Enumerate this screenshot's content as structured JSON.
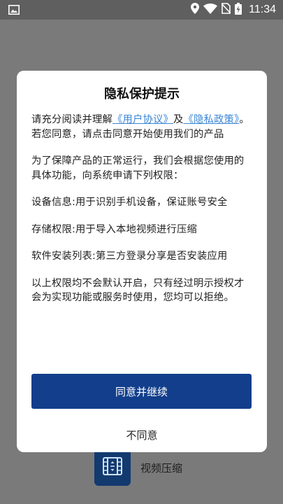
{
  "status_bar": {
    "time": "11:34",
    "icons": [
      "image-notification-icon",
      "location-icon",
      "wifi-icon",
      "no-sim-icon",
      "battery-charging-icon"
    ]
  },
  "dialog": {
    "title": "隐私保护提示",
    "intro_prefix": "请充分阅读并理解",
    "user_agreement_link": "《用户协议》",
    "and": "及",
    "privacy_policy_link": "《隐私政策》",
    "intro_suffix": "。若您同意，请点击同意开始使用我们的产品",
    "purpose": "为了保障产品的正常运行，我们会根据您使用的具体功能，向系统申请下列权限：",
    "permission_device": "设备信息:用于识别手机设备，保证账号安全",
    "permission_storage": "存储权限:用于导入本地视频进行压缩",
    "permission_apps": "软件安装列表:第三方登录分享是否安装应用",
    "closing": "以上权限均不会默认开启，只有经过明示授权才会为实现功能或服务时使用，您均可以拒绝。",
    "agree_button": "同意并继续",
    "disagree_button": "不同意"
  },
  "background_app": {
    "label": "视频压缩",
    "icon": "video-compress-icon"
  },
  "colors": {
    "accent": "#123e8b",
    "link": "#3a86d6",
    "scrim": "#7a7a7a",
    "app_icon_bg": "#123a6f"
  }
}
